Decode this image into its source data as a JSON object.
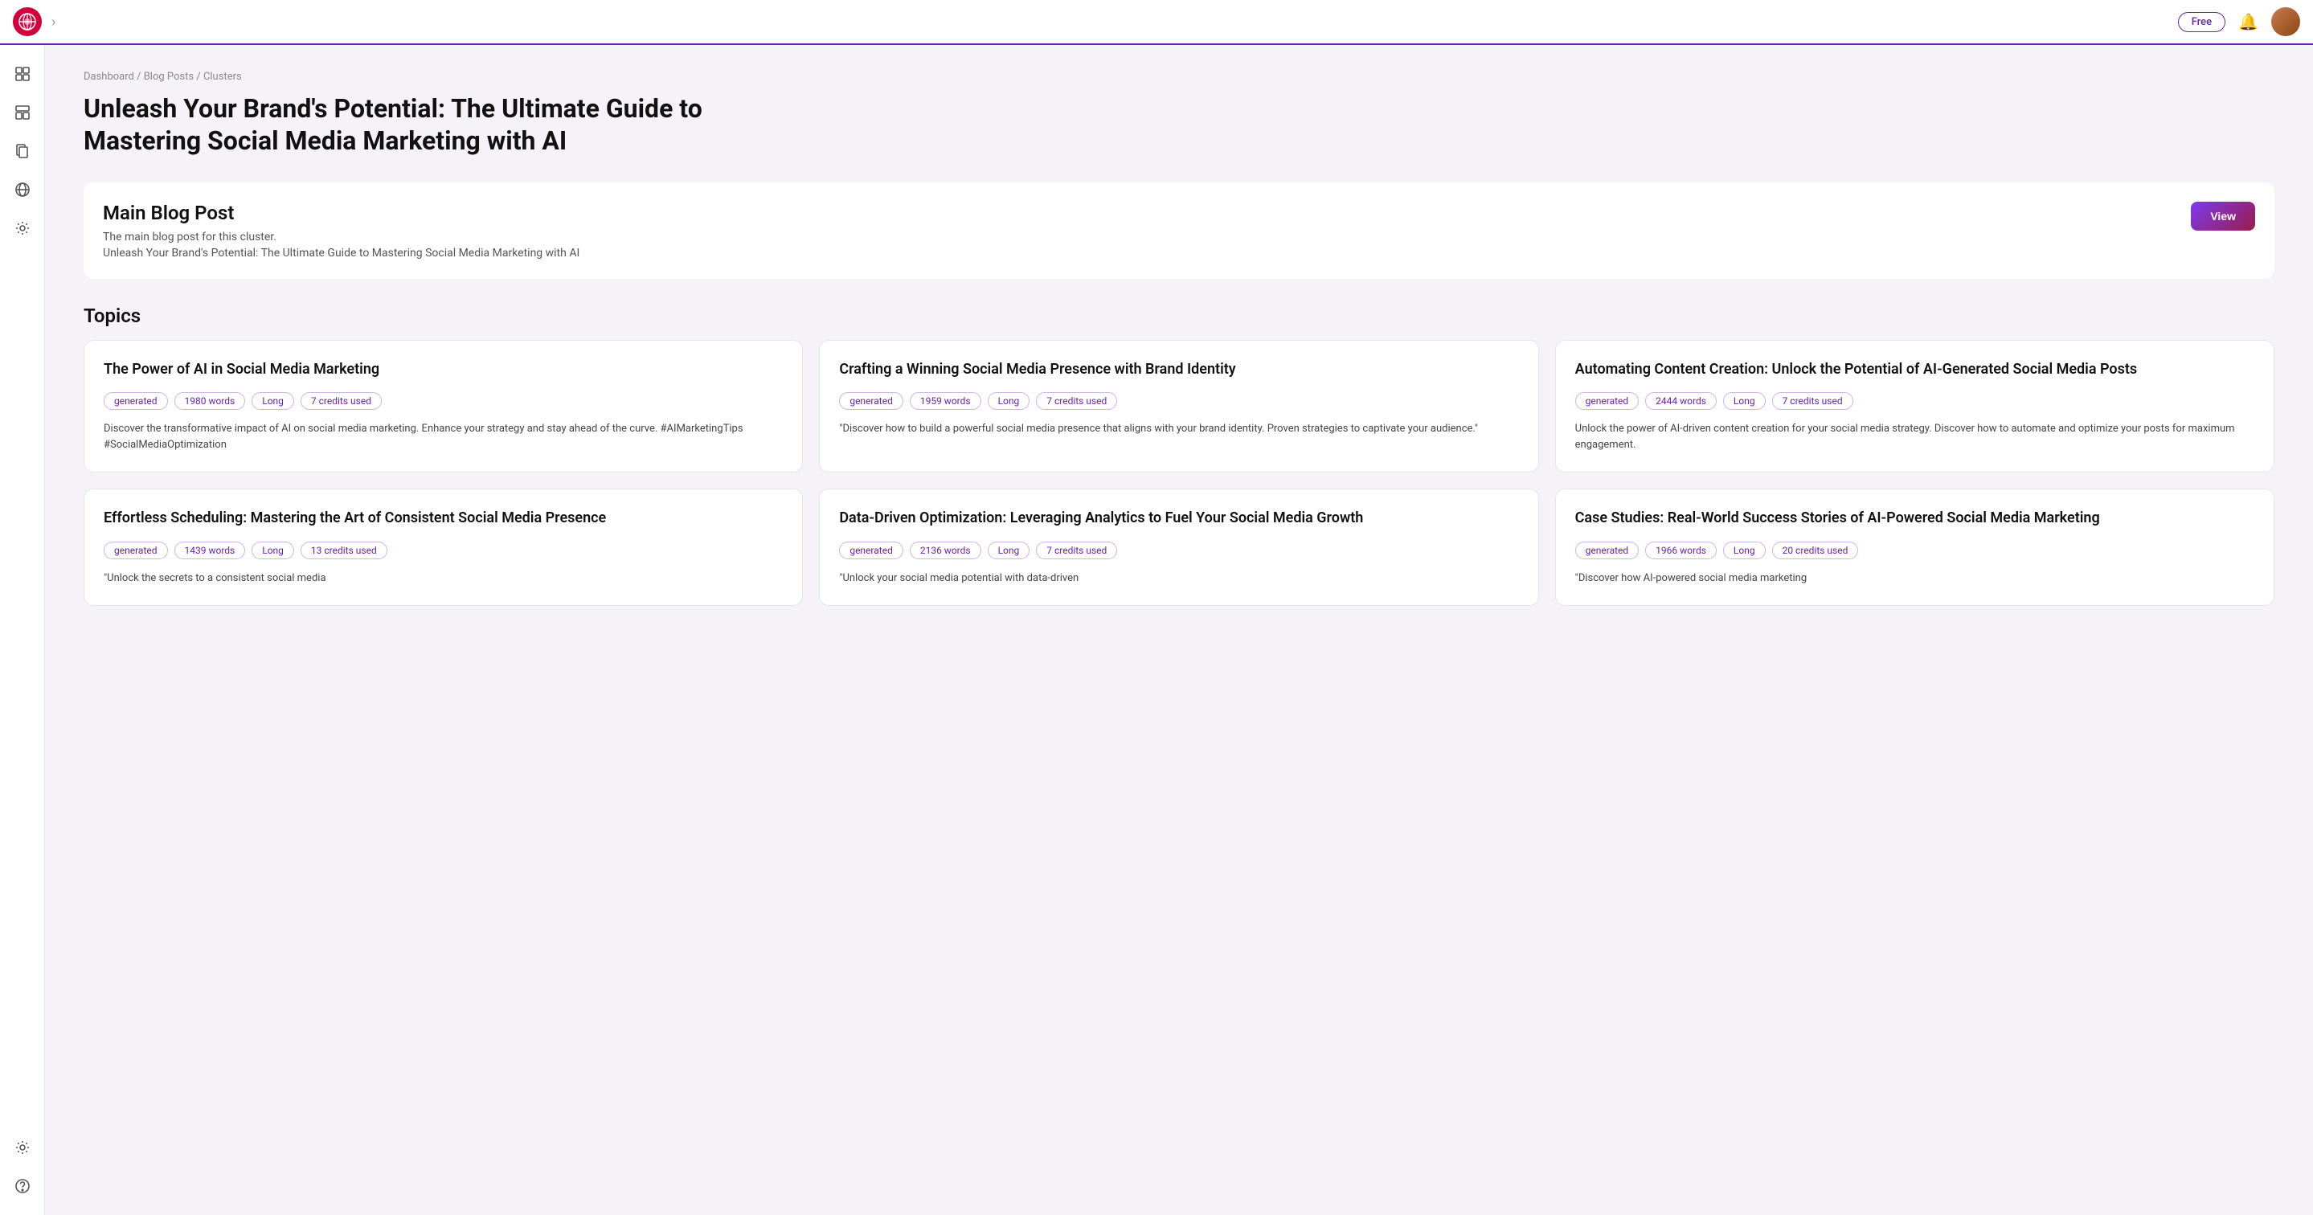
{
  "topbar": {
    "free_label": "Free",
    "chevron": "›"
  },
  "breadcrumb": {
    "items": [
      "Dashboard",
      "Blog Posts",
      "Clusters"
    ]
  },
  "page_title": "Unleash Your Brand's Potential: The Ultimate Guide to Mastering Social Media Marketing with AI",
  "main_blog": {
    "section_title": "Main Blog Post",
    "description": "The main blog post for this cluster.",
    "link_text": "Unleash Your Brand's Potential: The Ultimate Guide to Mastering Social Media Marketing with AI",
    "view_button": "View"
  },
  "topics": {
    "section_title": "Topics",
    "cards": [
      {
        "title": "The Power of AI in Social Media Marketing",
        "tags": [
          "generated",
          "1980 words",
          "Long",
          "7 credits used"
        ],
        "description": "Discover the transformative impact of AI on social media marketing. Enhance your strategy and stay ahead of the curve. #AIMarketingTips #SocialMediaOptimization"
      },
      {
        "title": "Crafting a Winning Social Media Presence with Brand Identity",
        "tags": [
          "generated",
          "1959 words",
          "Long",
          "7 credits used"
        ],
        "description": "\"Discover how to build a powerful social media presence that aligns with your brand identity. Proven strategies to captivate your audience.\""
      },
      {
        "title": "Automating Content Creation: Unlock the Potential of AI-Generated Social Media Posts",
        "tags": [
          "generated",
          "2444 words",
          "Long",
          "7 credits used"
        ],
        "description": "Unlock the power of AI-driven content creation for your social media strategy. Discover how to automate and optimize your posts for maximum engagement."
      },
      {
        "title": "Effortless Scheduling: Mastering the Art of Consistent Social Media Presence",
        "tags": [
          "generated",
          "1439 words",
          "Long",
          "13 credits used"
        ],
        "description": "\"Unlock the secrets to a consistent social media"
      },
      {
        "title": "Data-Driven Optimization: Leveraging Analytics to Fuel Your Social Media Growth",
        "tags": [
          "generated",
          "2136 words",
          "Long",
          "7 credits used"
        ],
        "description": "\"Unlock your social media potential with data-driven"
      },
      {
        "title": "Case Studies: Real-World Success Stories of AI-Powered Social Media Marketing",
        "tags": [
          "generated",
          "1966 words",
          "Long",
          "20 credits used"
        ],
        "description": "\"Discover how AI-powered social media marketing"
      }
    ]
  },
  "sidebar": {
    "items": [
      {
        "name": "dashboard",
        "icon": "⊞"
      },
      {
        "name": "templates",
        "icon": "⊟"
      },
      {
        "name": "documents",
        "icon": "⧉"
      },
      {
        "name": "globe",
        "icon": "🌐"
      },
      {
        "name": "tools",
        "icon": "✦"
      }
    ],
    "bottom_items": [
      {
        "name": "settings",
        "icon": "⚙"
      },
      {
        "name": "help",
        "icon": "⊕"
      }
    ]
  }
}
